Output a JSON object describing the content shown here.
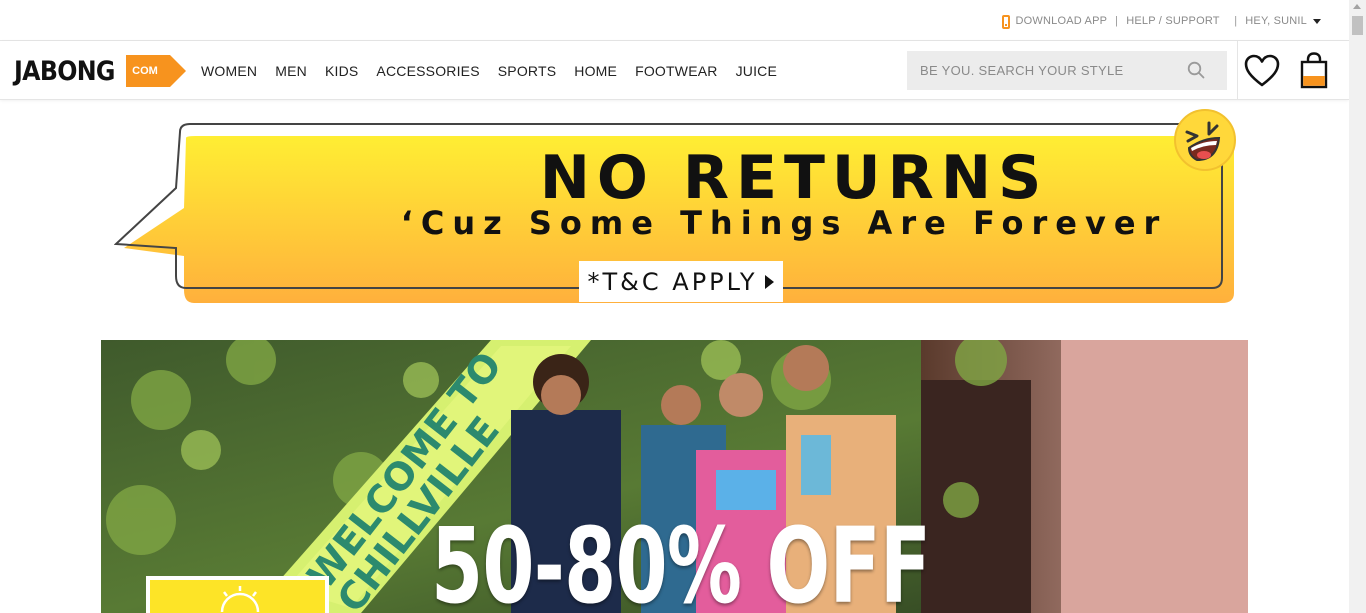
{
  "utility": {
    "download_app": "DOWNLOAD APP",
    "help_support": "HELP / SUPPORT",
    "greeting": "HEY, SUNIL"
  },
  "header": {
    "logo_main": "JABONG",
    "logo_suffix": "COM",
    "nav": [
      "WOMEN",
      "MEN",
      "KIDS",
      "ACCESSORIES",
      "SPORTS",
      "HOME",
      "FOOTWEAR",
      "JUICE"
    ],
    "search_placeholder": "BE YOU. SEARCH YOUR STYLE"
  },
  "promo": {
    "title": "NO RETURNS",
    "subtitle": "‘Cuz Some Things Are Forever",
    "cta": "*T&C APPLY"
  },
  "hero": {
    "float_line1": "WELCOME TO",
    "float_line2": "CHILLVILLE",
    "offer": "50-80% OFF"
  },
  "colors": {
    "brand_orange": "#f7931e",
    "banner_yellow_top": "#ffe934",
    "banner_yellow_bottom": "#ffb23c"
  }
}
